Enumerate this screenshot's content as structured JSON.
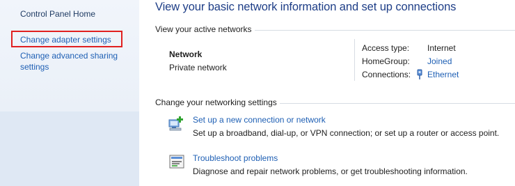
{
  "sidebar": {
    "home_label": "Control Panel Home",
    "items": [
      {
        "label": "Change adapter settings"
      },
      {
        "label_line1": "Change advanced sharing",
        "label_line2": "settings"
      }
    ]
  },
  "main": {
    "title": "View your basic network information and set up connections",
    "active_networks": {
      "heading": "View your active networks",
      "network_name": "Network",
      "network_category": "Private network",
      "details": [
        {
          "label": "Access type:",
          "value": "Internet"
        },
        {
          "label": "HomeGroup:",
          "value": "Joined"
        },
        {
          "label": "Connections:",
          "value": "Ethernet",
          "icon": "ethernet-icon"
        }
      ]
    },
    "settings": {
      "heading": "Change your networking settings",
      "tasks": [
        {
          "icon": "new-connection-icon",
          "label": "Set up a new connection or network",
          "description": "Set up a broadband, dial-up, or VPN connection; or set up a router or access point."
        },
        {
          "icon": "troubleshoot-icon",
          "label": "Troubleshoot problems",
          "description": "Diagnose and repair network problems, or get troubleshooting information."
        }
      ]
    }
  },
  "colors": {
    "link": "#1e5fb4",
    "title": "#1e3e87",
    "highlight_box": "#e02020",
    "sidebar_bg": "#eaf0f8"
  }
}
